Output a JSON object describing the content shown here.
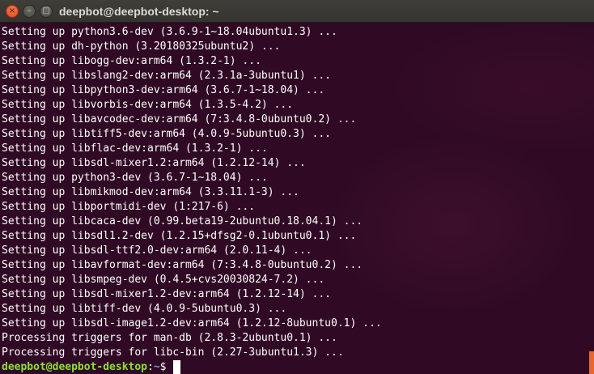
{
  "window": {
    "title": "deepbot@deepbot-desktop: ~",
    "close_glyph": "×",
    "minimize_glyph": "–",
    "maximize_glyph": "□"
  },
  "colors": {
    "terminal_bg": "#300a24",
    "text": "#ffffff",
    "prompt_user": "#8ae234",
    "prompt_path": "#729fcf",
    "close_button": "#df4b16",
    "scrollbar": "#e9662c"
  },
  "terminal": {
    "lines": [
      "Setting up python3.6-dev (3.6.9-1~18.04ubuntu1.3) ...",
      "Setting up dh-python (3.20180325ubuntu2) ...",
      "Setting up libogg-dev:arm64 (1.3.2-1) ...",
      "Setting up libslang2-dev:arm64 (2.3.1a-3ubuntu1) ...",
      "Setting up libpython3-dev:arm64 (3.6.7-1~18.04) ...",
      "Setting up libvorbis-dev:arm64 (1.3.5-4.2) ...",
      "Setting up libavcodec-dev:arm64 (7:3.4.8-0ubuntu0.2) ...",
      "Setting up libtiff5-dev:arm64 (4.0.9-5ubuntu0.3) ...",
      "Setting up libflac-dev:arm64 (1.3.2-1) ...",
      "Setting up libsdl-mixer1.2:arm64 (1.2.12-14) ...",
      "Setting up python3-dev (3.6.7-1~18.04) ...",
      "Setting up libmikmod-dev:arm64 (3.3.11.1-3) ...",
      "Setting up libportmidi-dev (1:217-6) ...",
      "Setting up libcaca-dev (0.99.beta19-2ubuntu0.18.04.1) ...",
      "Setting up libsdl1.2-dev (1.2.15+dfsg2-0.1ubuntu0.1) ...",
      "Setting up libsdl-ttf2.0-dev:arm64 (2.0.11-4) ...",
      "Setting up libavformat-dev:arm64 (7:3.4.8-0ubuntu0.2) ...",
      "Setting up libsmpeg-dev (0.4.5+cvs20030824-7.2) ...",
      "Setting up libsdl-mixer1.2-dev:arm64 (1.2.12-14) ...",
      "Setting up libtiff-dev (4.0.9-5ubuntu0.3) ...",
      "Setting up libsdl-image1.2-dev:arm64 (1.2.12-8ubuntu0.1) ...",
      "Processing triggers for man-db (2.8.3-2ubuntu0.1) ...",
      "Processing triggers for libc-bin (2.27-3ubuntu1.3) ..."
    ],
    "prompt": {
      "user_host": "deepbot@deepbot-desktop",
      "separator": ":",
      "path": "~",
      "symbol": "$"
    }
  }
}
